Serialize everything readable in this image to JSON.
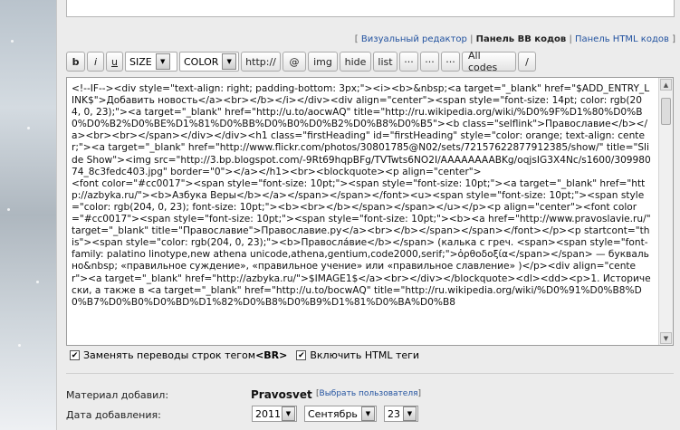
{
  "mode_links": {
    "visual": "Визуальный редактор",
    "bb": "Панель BB кодов",
    "html": "Панель HTML кодов"
  },
  "toolbar": {
    "bold": "b",
    "italic": "i",
    "underline": "u",
    "size": "SIZE",
    "color": "COLOR",
    "http": "http://",
    "at": "@",
    "img": "img",
    "hide": "hide",
    "list": "list",
    "ellipsis1": "···",
    "ellipsis2": "···",
    "ellipsis3": "···",
    "all_codes": "All codes",
    "slash": "/"
  },
  "editor": {
    "content": "<!--IF--><div style=\"text-align: right; padding-bottom: 3px;\"><i><b>&nbsp;<a target=\"_blank\" href=\"$ADD_ENTRY_LINK$\">Добавить новость</a><br></b></i></div><div align=\"center\"><span style=\"font-size: 14pt; color: rgb(204, 0, 23);\"><a target=\"_blank\" href=\"http://u.to/aocwAQ\" title=\"http://ru.wikipedia.org/wiki/%D0%9F%D1%80%D0%B0%D0%B2%D0%BE%D1%81%D0%BB%D0%B0%D0%B2%D0%B8%D0%B5\"><b class=\"selflink\">Православие</b></a><br><br></span></div></div><h1 class=\"firstHeading\" id=\"firstHeading\" style=\"color: orange; text-align: center;\"><a target=\"_blank\" href=\"http://www.flickr.com/photos/30801785@N02/sets/72157622877912385/show/\" title=\"Slide Show\"><img src=\"http://3.bp.blogspot.com/-9Rt69hqpBFg/TVTwts6NO2I/AAAAAAAABKg/oqjsIG3X4Nc/s1600/30998074_8c3fedc403.jpg\" border=\"0\"></a></h1><br><blockquote><p align=\"center\">\n<font color=\"#cc0017\"><span style=\"font-size: 10pt;\"><span style=\"font-size: 10pt;\"><a target=\"_blank\" href=\"http://azbyka.ru/\"><b>Азбука Веры</b></a></span></span></font><u><span style=\"font-size: 10pt;\"><span style=\"color: rgb(204, 0, 23); font-size: 10pt;\"><b><br></b></span></span></u></p><p align=\"center\"><font color=\"#cc0017\"><span style=\"font-size: 10pt;\"><span style=\"font-size: 10pt;\"><b><a href=\"http://www.pravoslavie.ru/\" target=\"_blank\" title=\"Православие\">Православие.ру</a><br></b></span></span></font></p><p startcont=\"this\"><span style=\"color: rgb(204, 0, 23);\"><b>Правосла́вие</b></span> (калька с греч. <span><span style=\"font-family: palatino linotype,new athena unicode,athena,gentium,code2000,serif;\">ὀρθοδοξία</span></span> — буквально&nbsp; «правильное суждение», «правильное учение» или «правильное славление» )</p><div align=\"center\"><a target=\"_blank\" href=\"http://azbyka.ru/\">$IMAGE1$</a><br></div></blockquote><dl><dd><p>1. Исторически, а также в <a target=\"_blank\" href=\"http://u.to/bocwAQ\" title=\"http://ru.wikipedia.org/wiki/%D0%91%D0%B8%D0%B7%D0%B0%D0%BD%D1%82%D0%B8%D0%B9%D1%81%D0%BA%D0%B8"
  },
  "options": {
    "replace_newlines_prefix": "Заменять переводы строк тегом ",
    "replace_newlines_tag": "<BR>",
    "enable_html": "Включить HTML теги"
  },
  "meta": {
    "author_label": "Материал добавил:",
    "author_name": "Pravosvet",
    "choose_user": "Выбрать пользователя",
    "date_label": "Дата добавления:",
    "year": "2011",
    "month": "Сентябрь",
    "day": "23"
  }
}
